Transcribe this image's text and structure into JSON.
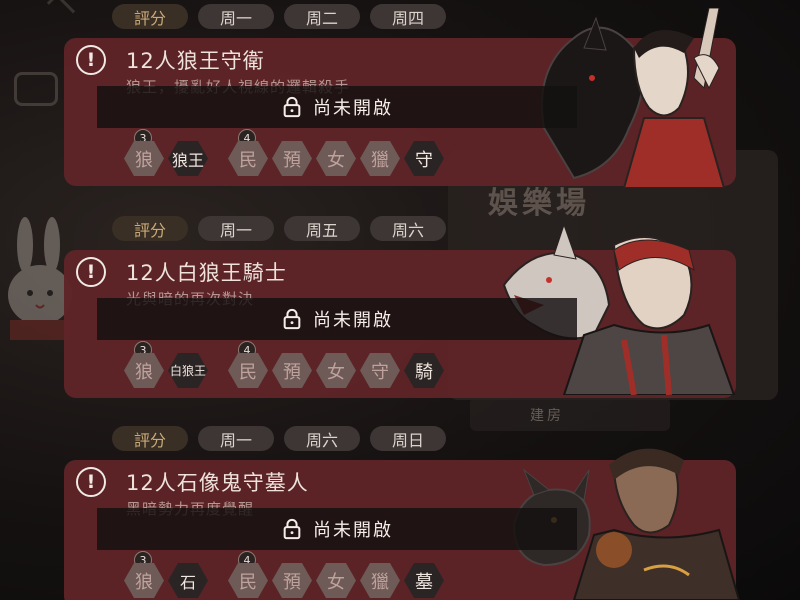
{
  "background": {
    "lobby_title": "娛樂場",
    "build_button": "建房"
  },
  "rooms": [
    {
      "days": [
        "評分",
        "周一",
        "周二",
        "周四"
      ],
      "title": "12人狼王守衛",
      "subtitle": "狼王，擾亂好人視線的邏輯殺手",
      "lock_label": "尚未開啟",
      "wolf_count": "3",
      "good_count": "4",
      "wolf_roles": [
        "狼",
        "狼王"
      ],
      "good_roles": [
        "民",
        "預",
        "女",
        "獵",
        "守"
      ]
    },
    {
      "days": [
        "評分",
        "周一",
        "周五",
        "周六"
      ],
      "title": "12人白狼王騎士",
      "subtitle": "光與暗的再次對決",
      "lock_label": "尚未開啟",
      "wolf_count": "3",
      "good_count": "4",
      "wolf_roles": [
        "狼",
        "白狼王"
      ],
      "good_roles": [
        "民",
        "預",
        "女",
        "守",
        "騎"
      ]
    },
    {
      "days": [
        "評分",
        "周一",
        "周六",
        "周日"
      ],
      "title": "12人石像鬼守墓人",
      "subtitle": "黑暗勢力再度覺醒",
      "lock_label": "尚未開啟",
      "wolf_count": "3",
      "good_count": "4",
      "wolf_roles": [
        "狼",
        "石"
      ],
      "good_roles": [
        "民",
        "預",
        "女",
        "獵",
        "墓"
      ]
    }
  ],
  "colors": {
    "card": "#5f2428",
    "chip": "#3d3634",
    "rate_chip_text": "#c9a97a",
    "lock_bar": "#141010"
  }
}
